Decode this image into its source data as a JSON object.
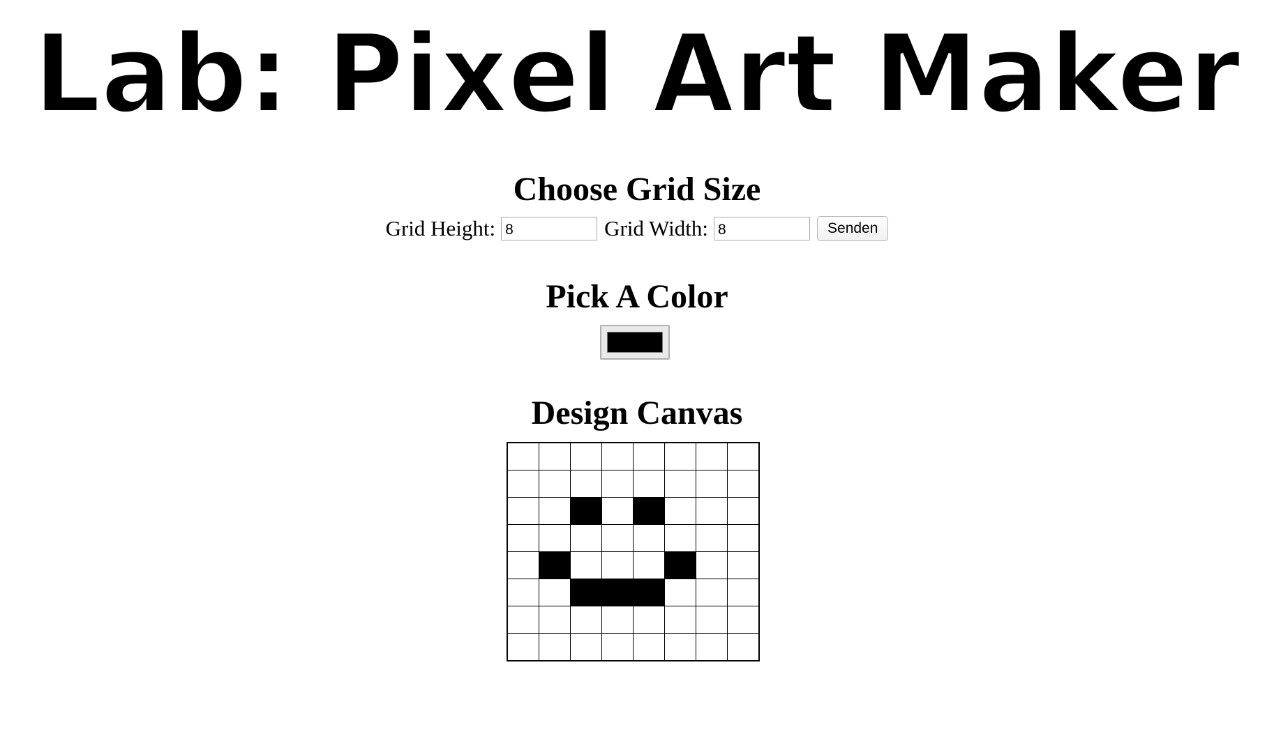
{
  "page": {
    "title": "Lab: Pixel Art Maker"
  },
  "size_section": {
    "heading": "Choose Grid Size",
    "height_label": "Grid Height:",
    "height_value": "8",
    "width_label": "Grid Width:",
    "width_value": "8",
    "submit_label": "Senden"
  },
  "color_section": {
    "heading": "Pick A Color",
    "selected_color": "#000000"
  },
  "canvas_section": {
    "heading": "Design Canvas",
    "rows": 8,
    "cols": 8,
    "cell_color": "#000000",
    "pixels": [
      [
        0,
        0,
        0,
        0,
        0,
        0,
        0,
        0
      ],
      [
        0,
        0,
        0,
        0,
        0,
        0,
        0,
        0
      ],
      [
        0,
        0,
        1,
        0,
        1,
        0,
        0,
        0
      ],
      [
        0,
        0,
        0,
        0,
        0,
        0,
        0,
        0
      ],
      [
        0,
        1,
        0,
        0,
        0,
        1,
        0,
        0
      ],
      [
        0,
        0,
        1,
        1,
        1,
        0,
        0,
        0
      ],
      [
        0,
        0,
        0,
        0,
        0,
        0,
        0,
        0
      ],
      [
        0,
        0,
        0,
        0,
        0,
        0,
        0,
        0
      ]
    ]
  }
}
